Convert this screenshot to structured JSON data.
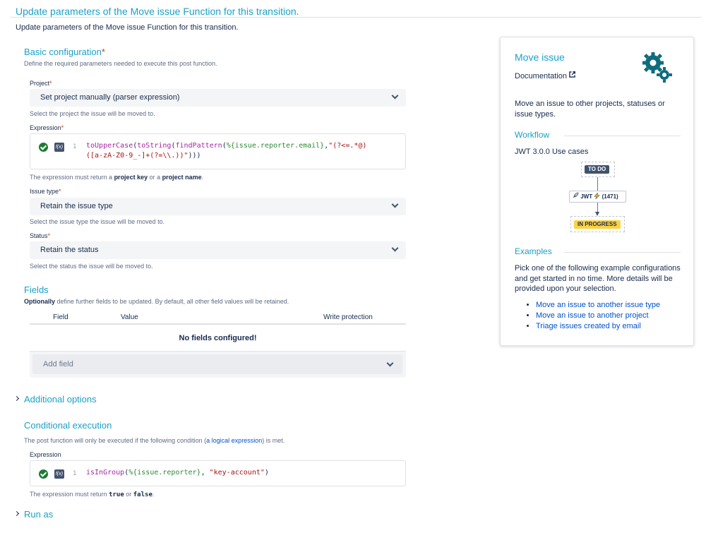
{
  "header": {
    "title": "Update parameters of the Move issue Function for this transition.",
    "subtitle": "Update parameters of the Move issue Function for this transition."
  },
  "basic": {
    "title": "Basic configuration",
    "required_mark": "*",
    "description": "Define the required parameters needed to execute this post function.",
    "project": {
      "label": "Project",
      "value": "Set project manually (parser expression)",
      "help": "Select the project the issue will be moved to."
    },
    "expression": {
      "label": "Expression",
      "line_number": "1",
      "help_prefix": "The expression must return a ",
      "help_key": "project key",
      "help_mid": " or a ",
      "help_name": "project name",
      "help_suffix": "."
    },
    "issue_type": {
      "label": "Issue type",
      "value": "Retain the issue type",
      "help": "Select the issue type the issue will be moved to."
    },
    "status": {
      "label": "Status",
      "value": "Retain the status",
      "help": "Select the status the issue will be moved to."
    }
  },
  "fields": {
    "title": "Fields",
    "desc_bold": "Optionally",
    "desc_rest": " define further fields to be updated. By default, all other field values will be retained.",
    "columns": [
      "Field",
      "Value",
      "Write protection"
    ],
    "empty": "No fields configured!",
    "add_placeholder": "Add field"
  },
  "additional": {
    "title": "Additional options"
  },
  "conditional": {
    "title": "Conditional execution",
    "desc_prefix": "The post function will only be executed if the following condition (",
    "desc_link": "a logical expression",
    "desc_suffix": ") is met.",
    "label": "Expression",
    "line_number": "1",
    "help_prefix": "The expression must return ",
    "help_true": "true",
    "help_mid": " or ",
    "help_false": "false",
    "help_suffix": "."
  },
  "run_as": {
    "title": "Run as"
  },
  "panel": {
    "title": "Move issue",
    "doc_label": "Documentation",
    "description": "Move an issue to other projects, statuses or issue types.",
    "workflow_heading": "Workflow",
    "use_case": "JWT 3.0.0 Use cases",
    "diagram": {
      "from": "TO DO",
      "transition": "JWT",
      "count": "(1471)",
      "to": "IN PROGRESS"
    },
    "examples_heading": "Examples",
    "examples_text": "Pick one of the following example configurations and get started in no time. More details will be provided upon your selection.",
    "examples": [
      "Move an issue to another issue type",
      "Move an issue to another project",
      "Triage issues created by email"
    ]
  },
  "colors": {
    "accent": "#1ba1c5",
    "link": "#0052cc",
    "success": "#1e7b34",
    "required": "#de350b",
    "lozenge_todo": "#42526e",
    "lozenge_inprogress": "#ffd23f"
  },
  "icons": [
    "check-icon",
    "fx-icon",
    "gears-icon",
    "external-link-icon",
    "chevron-down-icon",
    "chevron-right-icon",
    "rocket-icon"
  ]
}
